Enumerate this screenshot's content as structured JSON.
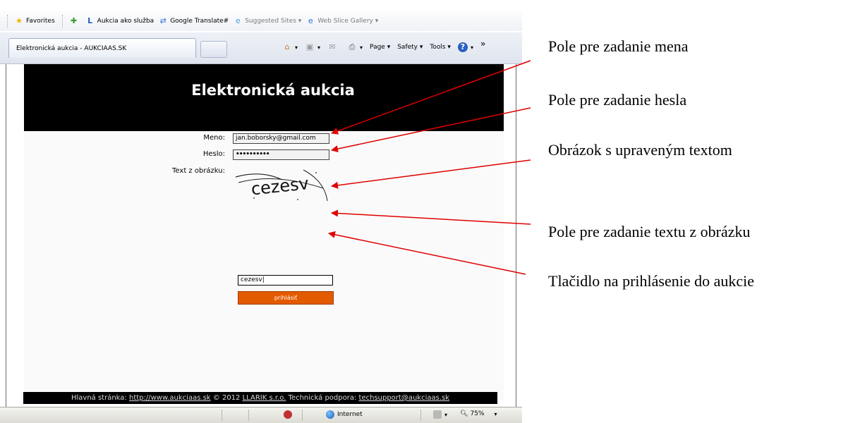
{
  "favorites_bar": {
    "favorites_label": "Favorites",
    "items": [
      "Aukcia ako služba",
      "Google Translate#",
      "Suggested Sites ▾",
      "Web Slice Gallery ▾"
    ]
  },
  "tab": {
    "title": "Elektronická aukcia - AUKCIAAS.SK"
  },
  "command_bar": {
    "page": "Page ▾",
    "safety": "Safety ▾",
    "tools": "Tools ▾",
    "overflow": "»"
  },
  "site": {
    "title": "Elektronická aukcia",
    "form": {
      "name_label": "Meno:",
      "name_value": "jan.boborsky@gmail.com",
      "password_label": "Heslo:",
      "password_value": "••••••••••",
      "captcha_label": "Text z obrázku:",
      "captcha_image_text": "cezesv",
      "captcha_value": "cezesv|",
      "submit_label": "prihlásiť"
    },
    "footer": {
      "main_label": "Hlavná stránka: ",
      "main_link": "http://www.aukciaas.sk",
      "copyright": " © 2012 ",
      "company": "LLARIK s.r.o.",
      "support_label": " Technická podpora: ",
      "support_email": "techsupport@aukciaas.sk"
    }
  },
  "status_bar": {
    "zone": "Internet",
    "zoom": "75%"
  },
  "annotations": [
    "Pole pre zadanie mena",
    "Pole pre zadanie hesla",
    "Obrázok s upraveným textom",
    "Pole pre zadanie textu z obrázku",
    "Tlačidlo na prihlásenie do aukcie"
  ],
  "colors": {
    "arrow": "#e00000",
    "button": "#e35a00",
    "header": "#000000"
  }
}
